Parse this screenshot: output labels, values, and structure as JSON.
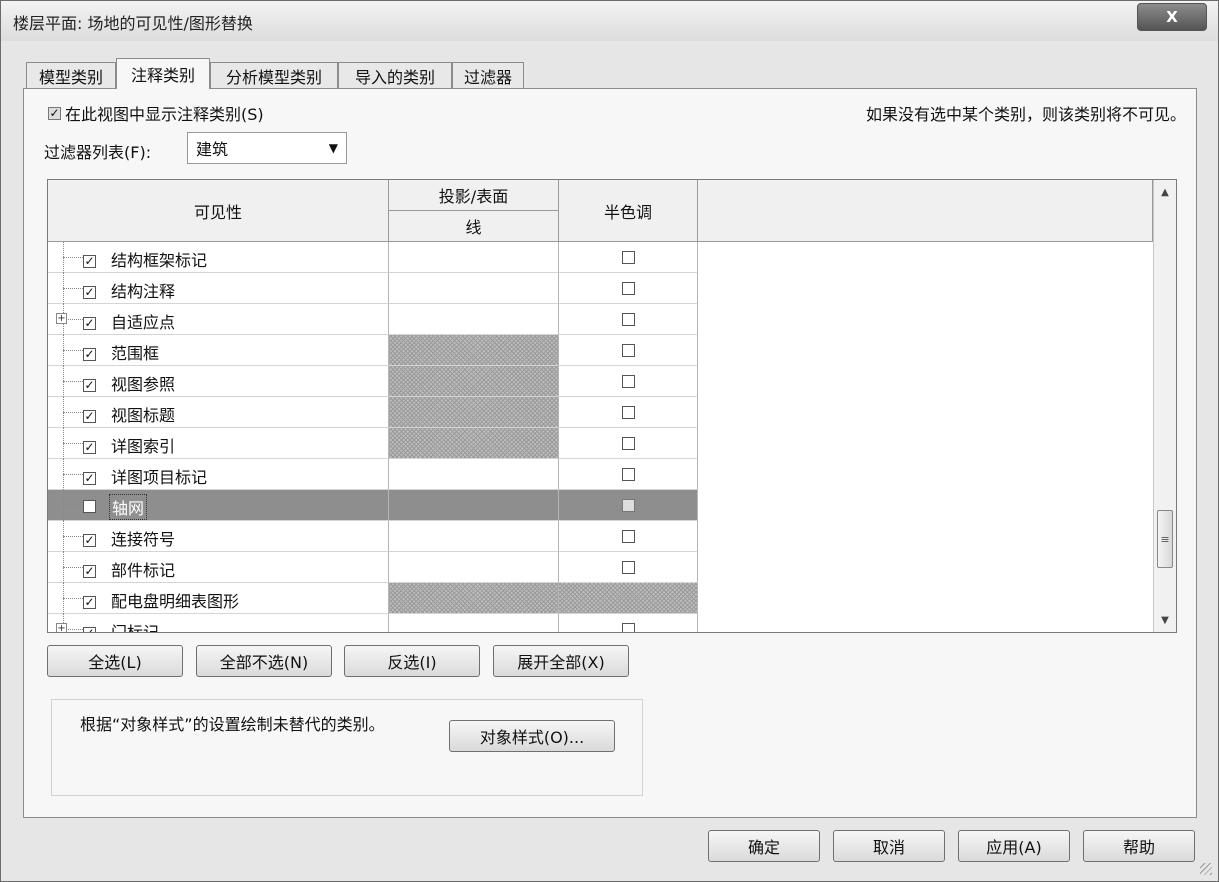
{
  "window": {
    "title": "楼层平面: 场地的可见性/图形替换",
    "close_glyph": "X"
  },
  "tabs": [
    {
      "label": "模型类别",
      "active": false
    },
    {
      "label": "注释类别",
      "active": true
    },
    {
      "label": "分析模型类别",
      "active": false
    },
    {
      "label": "导入的类别",
      "active": false
    },
    {
      "label": "过滤器",
      "active": false
    }
  ],
  "panel": {
    "show_checkbox_label": "在此视图中显示注释类别(S)",
    "show_checkbox_checked": true,
    "hint": "如果没有选中某个类别，则该类别将不可见。",
    "filter_label": "过滤器列表(F):",
    "filter_value": "建筑"
  },
  "table": {
    "headers": {
      "visibility": "可见性",
      "projection": "投影/表面",
      "line": "线",
      "halftone": "半色调"
    },
    "rows": [
      {
        "name": "结构框架标记",
        "checked": true,
        "hatched": false,
        "halftone_hatched": false,
        "expandable": false,
        "selected": false
      },
      {
        "name": "结构注释",
        "checked": true,
        "hatched": false,
        "halftone_hatched": false,
        "expandable": false,
        "selected": false
      },
      {
        "name": "自适应点",
        "checked": true,
        "hatched": false,
        "halftone_hatched": false,
        "expandable": true,
        "selected": false
      },
      {
        "name": "范围框",
        "checked": true,
        "hatched": true,
        "halftone_hatched": false,
        "expandable": false,
        "selected": false
      },
      {
        "name": "视图参照",
        "checked": true,
        "hatched": true,
        "halftone_hatched": false,
        "expandable": false,
        "selected": false
      },
      {
        "name": "视图标题",
        "checked": true,
        "hatched": true,
        "halftone_hatched": false,
        "expandable": false,
        "selected": false
      },
      {
        "name": "详图索引",
        "checked": true,
        "hatched": true,
        "halftone_hatched": false,
        "expandable": false,
        "selected": false
      },
      {
        "name": "详图项目标记",
        "checked": true,
        "hatched": false,
        "halftone_hatched": false,
        "expandable": false,
        "selected": false
      },
      {
        "name": "轴网",
        "checked": false,
        "hatched": false,
        "halftone_hatched": false,
        "expandable": false,
        "selected": true
      },
      {
        "name": "连接符号",
        "checked": true,
        "hatched": false,
        "halftone_hatched": false,
        "expandable": false,
        "selected": false
      },
      {
        "name": "部件标记",
        "checked": true,
        "hatched": false,
        "halftone_hatched": false,
        "expandable": false,
        "selected": false
      },
      {
        "name": "配电盘明细表图形",
        "checked": true,
        "hatched": true,
        "halftone_hatched": true,
        "expandable": false,
        "selected": false
      },
      {
        "name": "门标记",
        "checked": true,
        "hatched": false,
        "halftone_hatched": false,
        "expandable": true,
        "selected": false
      }
    ]
  },
  "buttons": {
    "select_all": "全选(L)",
    "select_none": "全部不选(N)",
    "invert": "反选(I)",
    "expand_all": "展开全部(X)",
    "object_styles": "对象样式(O)...",
    "ok": "确定",
    "cancel": "取消",
    "apply": "应用(A)",
    "help": "帮助"
  },
  "note": "根据“对象样式”的设置绘制未替代的类别。"
}
